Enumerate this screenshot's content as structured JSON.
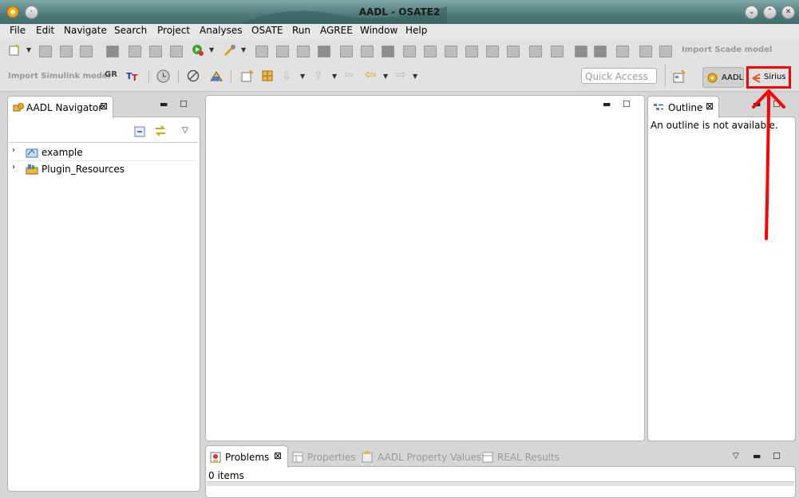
{
  "window": {
    "title": "AADL - OSATE2"
  },
  "menu": [
    "File",
    "Edit",
    "Navigate",
    "Search",
    "Project",
    "Analyses",
    "OSATE",
    "Run",
    "AGREE",
    "Window",
    "Help"
  ],
  "toolbar": {
    "import_scade_label": "Import Scade model",
    "import_simulink_label": "Import Simulink model",
    "gr_label": "GR",
    "quick_access_placeholder": "Quick Access",
    "perspective_aadl": "AADL",
    "perspective_sirius": "Sirius"
  },
  "navigator": {
    "tab_label": "AADL Navigator",
    "items": [
      {
        "label": "example"
      },
      {
        "label": "Plugin_Resources"
      }
    ]
  },
  "outline": {
    "tab_label": "Outline",
    "message": "An outline is not available."
  },
  "bottom": {
    "tabs": [
      "Problems",
      "Properties",
      "AADL Property Values",
      "REAL Results"
    ],
    "status": "0 items"
  },
  "colors": {
    "highlight": "#ff0000",
    "title_bar": "#4e7b7a",
    "panel_border": "#b4b4b4"
  }
}
